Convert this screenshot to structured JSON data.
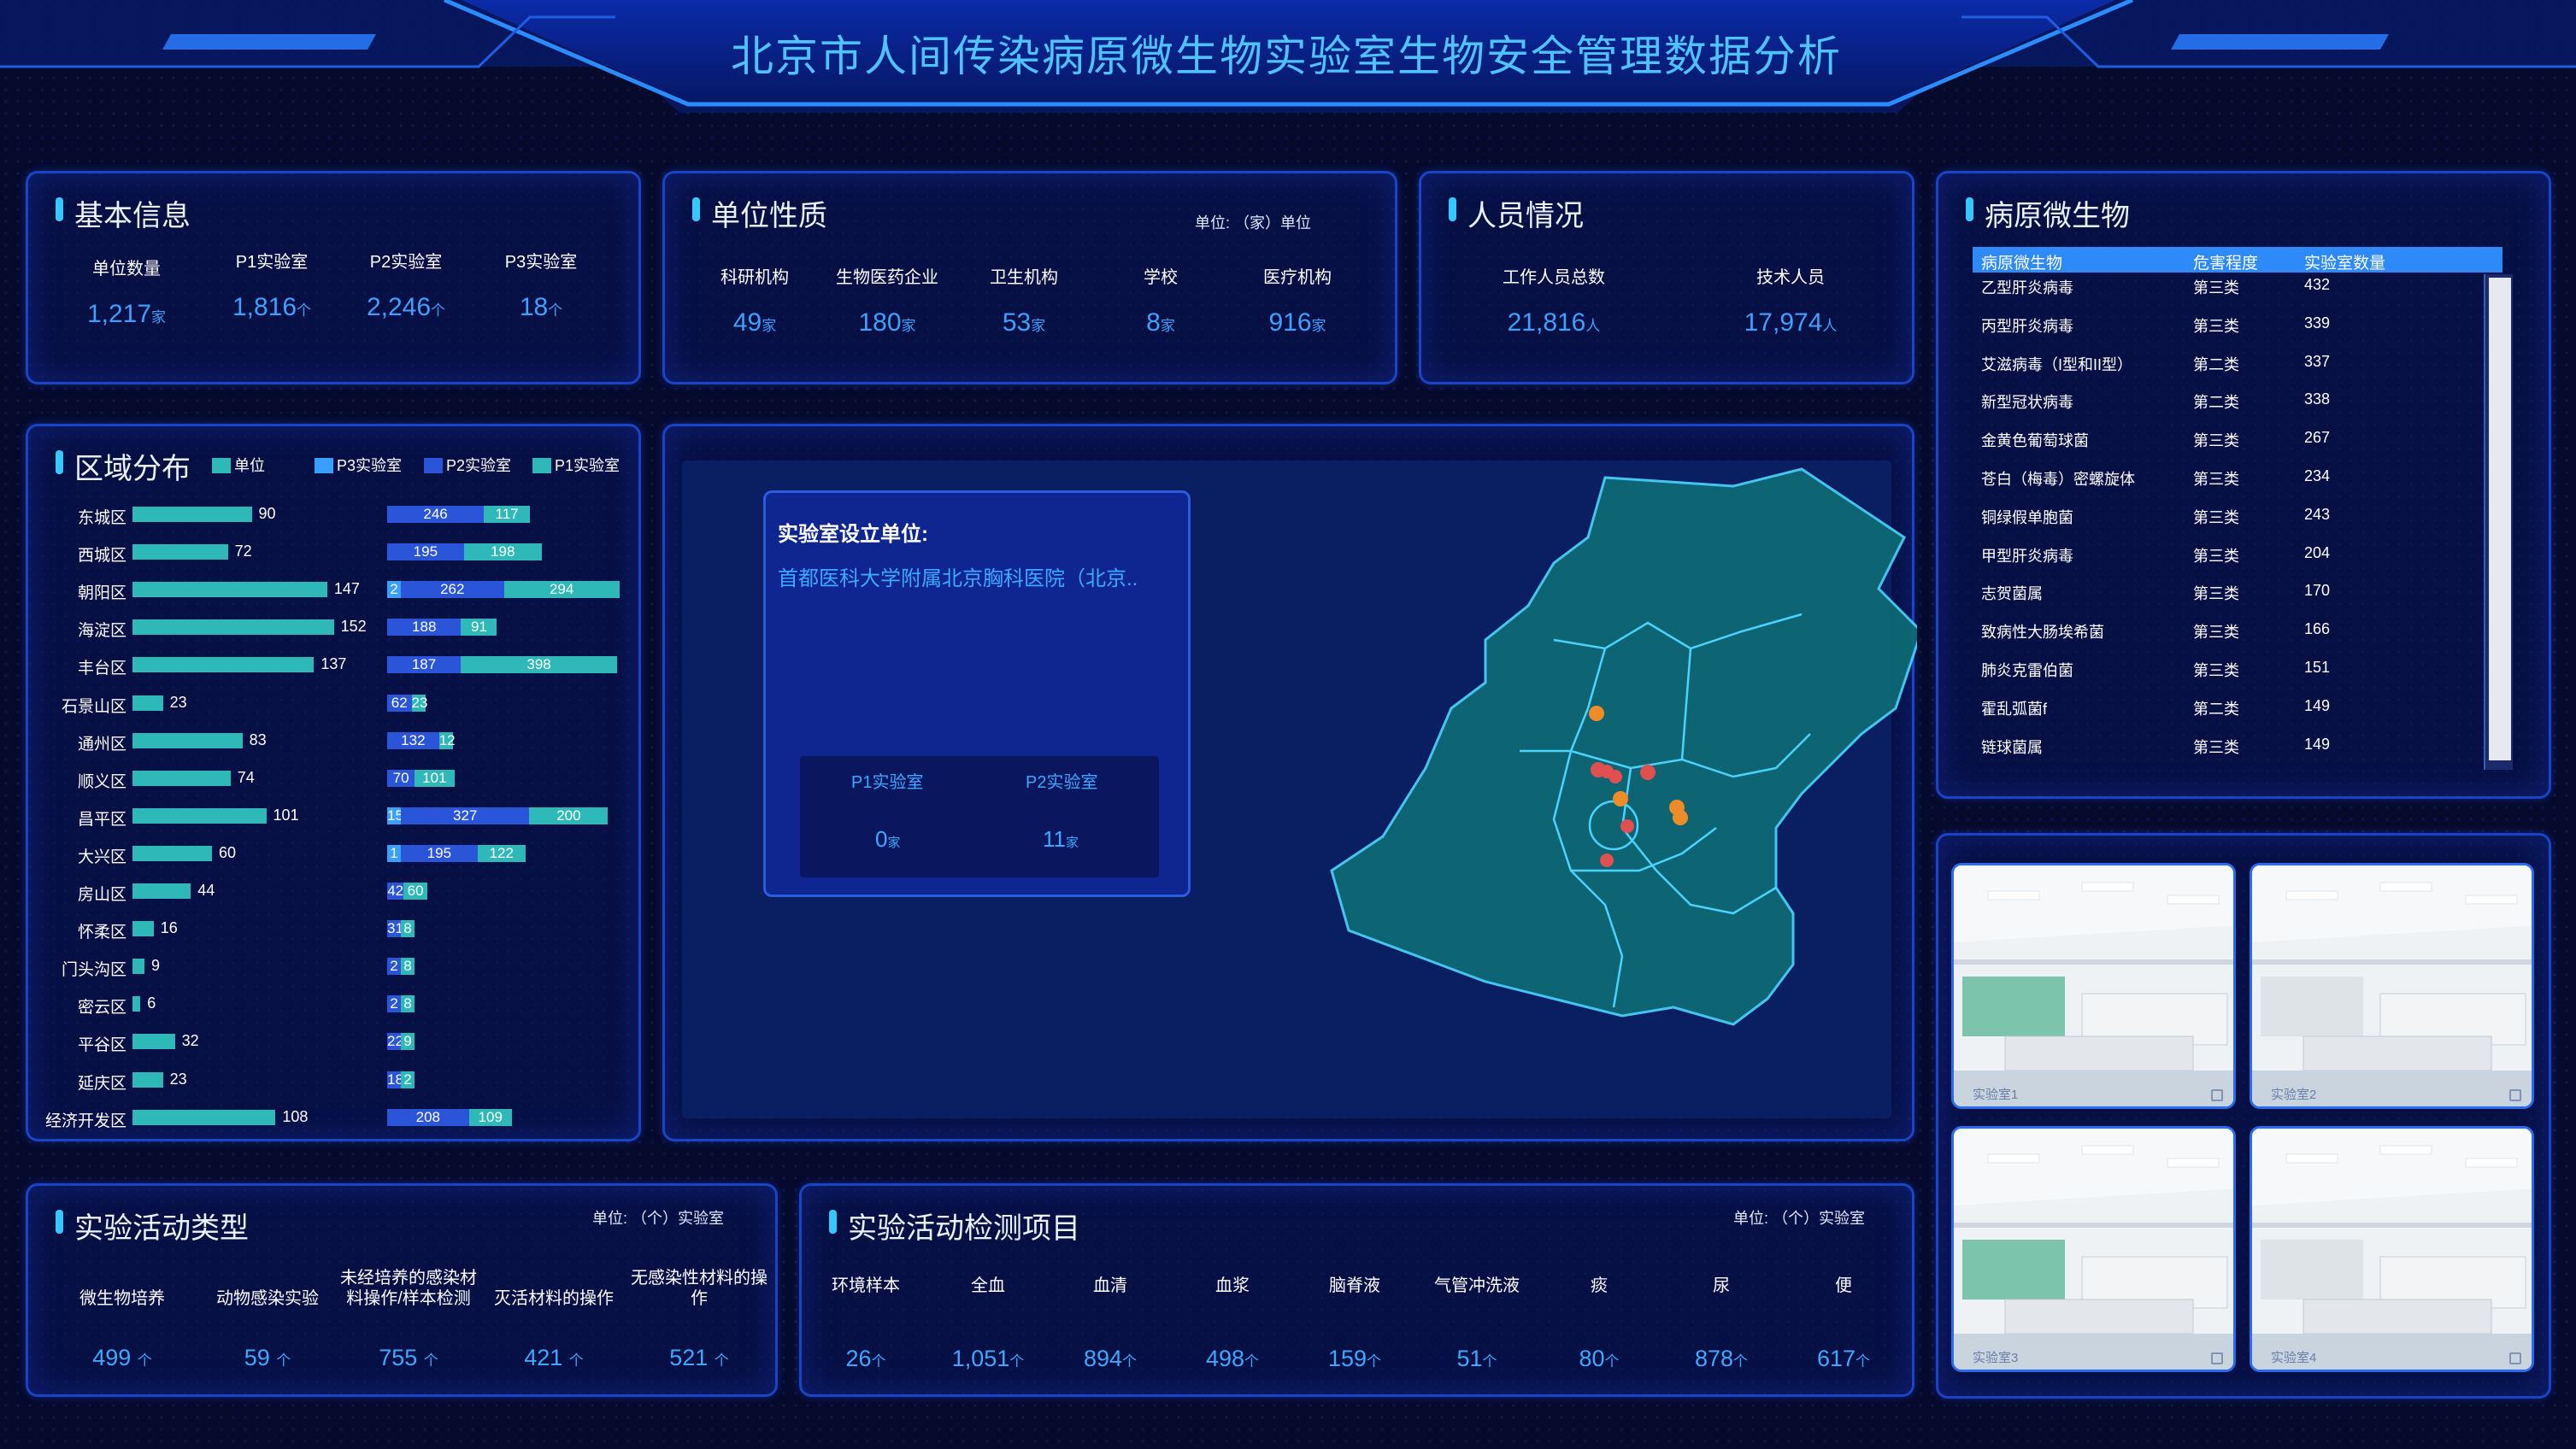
{
  "title": "北京市人间传染病原微生物实验室生物安全管理数据分析",
  "basic": {
    "title": "基本信息",
    "items": [
      {
        "label": "单位数量",
        "value": "1,217",
        "unit": "家"
      },
      {
        "label": "P1实验室",
        "value": "1,816",
        "unit": "个"
      },
      {
        "label": "P2实验室",
        "value": "2,246",
        "unit": "个"
      },
      {
        "label": "P3实验室",
        "value": "18",
        "unit": "个"
      }
    ]
  },
  "nature": {
    "title": "单位性质",
    "unit": "单位: （家）单位",
    "items": [
      {
        "label": "科研机构",
        "value": "49",
        "unit": "家"
      },
      {
        "label": "生物医药企业",
        "value": "180",
        "unit": "家"
      },
      {
        "label": "卫生机构",
        "value": "53",
        "unit": "家"
      },
      {
        "label": "学校",
        "value": "8",
        "unit": "家"
      },
      {
        "label": "医疗机构",
        "value": "916",
        "unit": "家"
      }
    ]
  },
  "staff": {
    "title": "人员情况",
    "items": [
      {
        "label": "工作人员总数",
        "value": "21,816",
        "unit": "人"
      },
      {
        "label": "技术人员",
        "value": "17,974",
        "unit": "人"
      }
    ]
  },
  "pathogen": {
    "title": "病原微生物",
    "headers": [
      "病原微生物",
      "危害程度",
      "实验室数量"
    ],
    "rows": [
      [
        "乙型肝炎病毒",
        "第三类",
        "432"
      ],
      [
        "丙型肝炎病毒",
        "第三类",
        "339"
      ],
      [
        "艾滋病毒（I型和II型）",
        "第二类",
        "337"
      ],
      [
        "新型冠状病毒",
        "第二类",
        "338"
      ],
      [
        "金黄色葡萄球菌",
        "第三类",
        "267"
      ],
      [
        "苍白（梅毒）密螺旋体",
        "第三类",
        "234"
      ],
      [
        "铜绿假单胞菌",
        "第三类",
        "243"
      ],
      [
        "甲型肝炎病毒",
        "第三类",
        "204"
      ],
      [
        "志贺菌属",
        "第三类",
        "170"
      ],
      [
        "致病性大肠埃希菌",
        "第三类",
        "166"
      ],
      [
        "肺炎克雷伯菌",
        "第三类",
        "151"
      ],
      [
        "霍乱弧菌f",
        "第二类",
        "149"
      ],
      [
        "链球菌属",
        "第三类",
        "149"
      ]
    ]
  },
  "region": {
    "title": "区域分布",
    "legend": [
      "单位",
      "P3实验室",
      "P2实验室",
      "P1实验室"
    ],
    "colors": {
      "unit": "#2fb8b8",
      "p3": "#3aa0ff",
      "p2": "#2b55d8",
      "p1": "#2fb8b8"
    },
    "rows": [
      {
        "name": "东城区",
        "unit": 90,
        "p3": "",
        "p2": 246,
        "p1": 117
      },
      {
        "name": "西城区",
        "unit": 72,
        "p3": "",
        "p2": 195,
        "p1": 198
      },
      {
        "name": "朝阳区",
        "unit": 147,
        "p3": 2,
        "p2": 262,
        "p1": 294
      },
      {
        "name": "海淀区",
        "unit": 152,
        "p3": "",
        "p2": 188,
        "p1": 91
      },
      {
        "name": "丰台区",
        "unit": 137,
        "p3": "",
        "p2": 187,
        "p1": 398
      },
      {
        "name": "石景山区",
        "unit": 23,
        "p3": "",
        "p2": 62,
        "p1": 23
      },
      {
        "name": "通州区",
        "unit": 83,
        "p3": "",
        "p2": 132,
        "p1": 12
      },
      {
        "name": "顺义区",
        "unit": 74,
        "p3": "",
        "p2": 70,
        "p1": 101
      },
      {
        "name": "昌平区",
        "unit": 101,
        "p3": 15,
        "p2": 327,
        "p1": 200
      },
      {
        "name": "大兴区",
        "unit": 60,
        "p3": 1,
        "p2": 195,
        "p1": 122
      },
      {
        "name": "房山区",
        "unit": 44,
        "p3": "",
        "p2": 42,
        "p1": 60
      },
      {
        "name": "怀柔区",
        "unit": 16,
        "p3": "",
        "p2": 31,
        "p1": 8
      },
      {
        "name": "门头沟区",
        "unit": 9,
        "p3": "",
        "p2": 2,
        "p1": 8
      },
      {
        "name": "密云区",
        "unit": 6,
        "p3": "",
        "p2": 2,
        "p1": 8
      },
      {
        "name": "平谷区",
        "unit": 32,
        "p3": "",
        "p2": 22,
        "p1": 9
      },
      {
        "name": "延庆区",
        "unit": 23,
        "p3": "",
        "p2": 18,
        "p1": 2
      },
      {
        "name": "经济开发区",
        "unit": 108,
        "p3": "",
        "p2": 208,
        "p1": 109
      }
    ]
  },
  "map": {
    "popup_title": "实验室设立单位:",
    "popup_unit": "首都医科大学附属北京胸科医院（北京..",
    "p1_label": "P1实验室",
    "p1_value": "0",
    "p2_label": "P2实验室",
    "p2_value": "11",
    "popup_suffix": "家"
  },
  "activity": {
    "title": "实验活动类型",
    "unit": "单位: （个）实验室",
    "items": [
      {
        "label": "微生物培养",
        "value": "499"
      },
      {
        "label": "动物感染实验",
        "value": "59"
      },
      {
        "label": "未经培养的感染材料操作/样本检测",
        "value": "755"
      },
      {
        "label": "灭活材料的操作",
        "value": "421"
      },
      {
        "label": "无感染性材料的操作",
        "value": "521"
      }
    ],
    "suffix": "个"
  },
  "detection": {
    "title": "实验活动检测项目",
    "unit": "单位: （个）实验室",
    "items": [
      {
        "label": "环境样本",
        "value": "26"
      },
      {
        "label": "全血",
        "value": "1,051"
      },
      {
        "label": "血清",
        "value": "894"
      },
      {
        "label": "血浆",
        "value": "498"
      },
      {
        "label": "脑脊液",
        "value": "159"
      },
      {
        "label": "气管冲洗液",
        "value": "51"
      },
      {
        "label": "痰",
        "value": "80"
      },
      {
        "label": "尿",
        "value": "878"
      },
      {
        "label": "便",
        "value": "617"
      }
    ],
    "suffix": "个"
  },
  "photos": [
    {
      "caption": "实验室1"
    },
    {
      "caption": "实验室2"
    },
    {
      "caption": "实验室3"
    },
    {
      "caption": "实验室4"
    }
  ]
}
